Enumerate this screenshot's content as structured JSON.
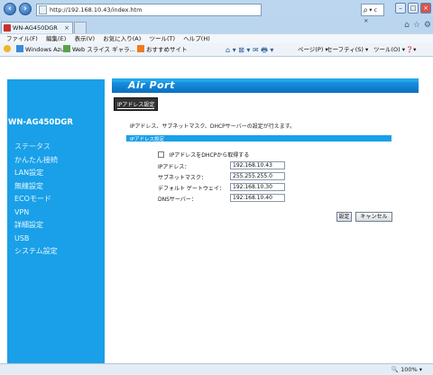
{
  "browser": {
    "url": "http://192.168.10.43/index.htm",
    "search_indicator": "ρ ▾ c ×",
    "tab_title": "WN-AG450DGR",
    "menu": [
      "ファイル(F)",
      "編集(E)",
      "表示(V)",
      "お気に入り(A)",
      "ツール(T)",
      "ヘルプ(H)"
    ],
    "favorites": [
      "Windows Azure",
      "Web スライス ギャラ...",
      "おすすめサイト"
    ],
    "command_bar": [
      "ページ(P) ▾",
      "セーフティ(S) ▾",
      "ツール(O) ▾"
    ],
    "zoom": "100%"
  },
  "page": {
    "logo": "Air Port",
    "device_name": "WN-AG450DGR",
    "nav": [
      "ステータス",
      "かんたん接続",
      "LAN設定",
      "無線設定",
      "ECOモード",
      "VPN",
      "詳細設定",
      "USB",
      "システム設定"
    ],
    "active_tab": "IPアドレス設定",
    "description": "IPアドレス、サブネットマスク、DHCPサーバーの設定が行えます。",
    "section_title": "IPアドレス設定",
    "dhcp_label": "IPアドレスをDHCPから取得する",
    "fields": [
      {
        "label": "IPアドレス：",
        "value": "192.168.10.43"
      },
      {
        "label": "サブネットマスク：",
        "value": "255.255.255.0"
      },
      {
        "label": "デフォルト ゲートウェイ：",
        "value": "192.168.10.30"
      },
      {
        "label": "DNSサーバー：",
        "value": "192.168.10.40"
      }
    ],
    "buttons": {
      "apply": "設定",
      "cancel": "キャンセル"
    }
  },
  "colors": {
    "accent": "#19a0e8",
    "header": "#0a6fc2"
  }
}
